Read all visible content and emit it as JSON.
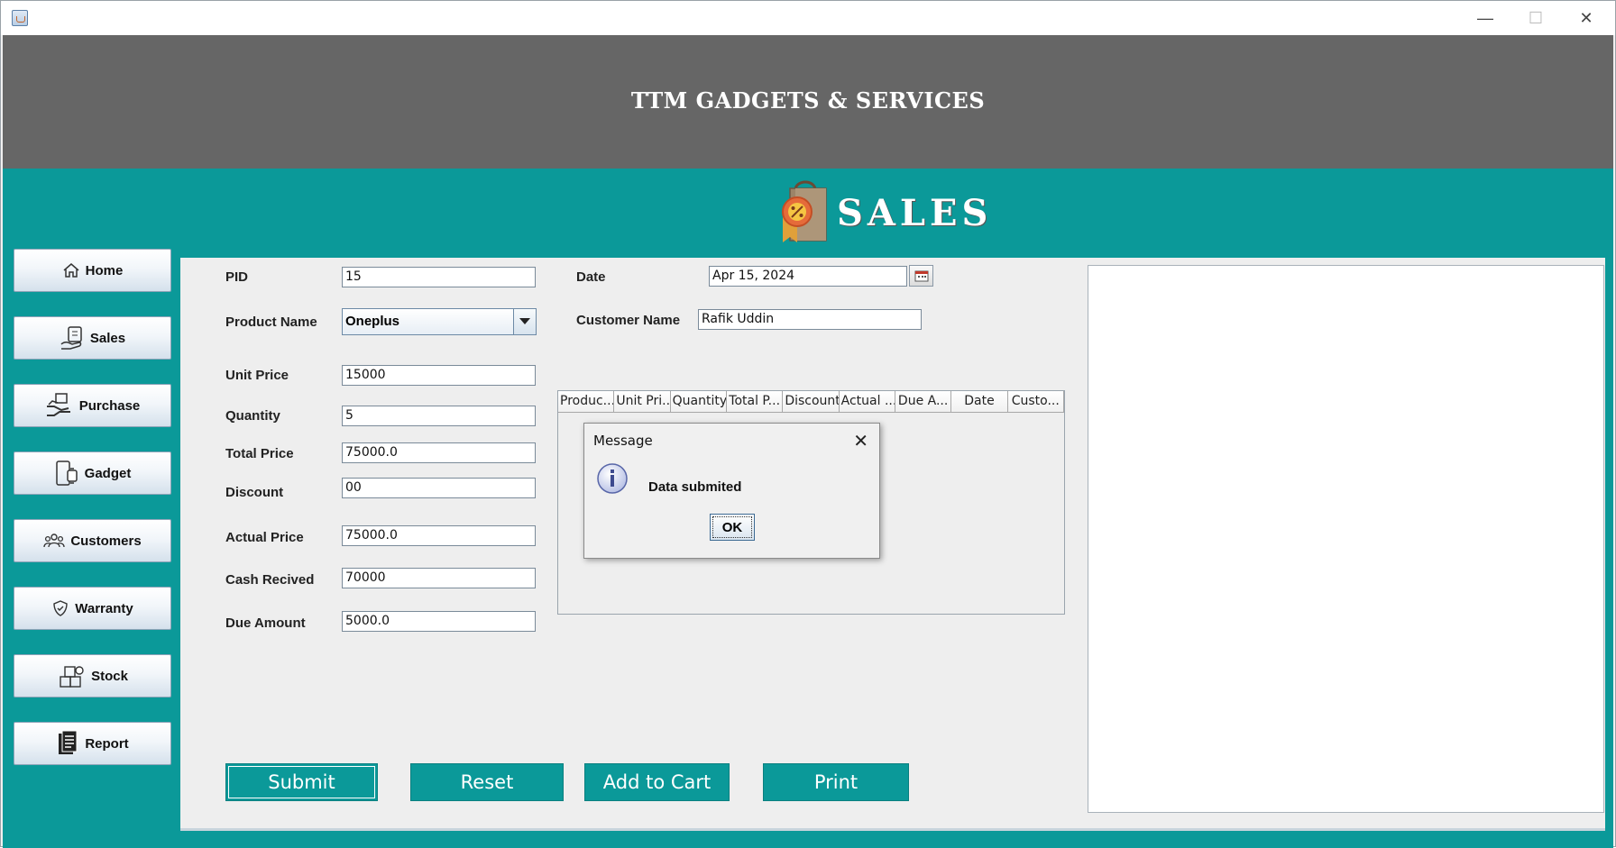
{
  "header": {
    "title": "TTM GADGETS & SERVICES"
  },
  "banner": {
    "title": "SALES"
  },
  "sidebar": {
    "items": [
      {
        "label": "Home",
        "icon": "home-icon"
      },
      {
        "label": "Sales",
        "icon": "sales-icon"
      },
      {
        "label": "Purchase",
        "icon": "purchase-icon"
      },
      {
        "label": "Gadget",
        "icon": "gadget-icon"
      },
      {
        "label": "Customers",
        "icon": "customers-icon"
      },
      {
        "label": "Warranty",
        "icon": "warranty-icon"
      },
      {
        "label": "Stock",
        "icon": "stock-icon"
      },
      {
        "label": "Report",
        "icon": "report-icon"
      }
    ]
  },
  "form": {
    "pid": {
      "label": "PID",
      "value": "15"
    },
    "product_name": {
      "label": "Product Name",
      "value": "Oneplus"
    },
    "unit_price": {
      "label": "Unit Price",
      "value": "15000"
    },
    "quantity": {
      "label": "Quantity",
      "value": "5"
    },
    "total_price": {
      "label": "Total Price",
      "value": "75000.0"
    },
    "discount": {
      "label": "Discount",
      "value": "00"
    },
    "actual_price": {
      "label": "Actual Price",
      "value": "75000.0"
    },
    "cash_received": {
      "label": "Cash Recived",
      "value": "70000"
    },
    "due_amount": {
      "label": "Due Amount",
      "value": "5000.0"
    },
    "date": {
      "label": "Date",
      "value": "Apr 15, 2024"
    },
    "customer_name": {
      "label": "Customer Name",
      "value": "Rafik Uddin"
    }
  },
  "table": {
    "columns": [
      "Produc...",
      "Unit Pri...",
      "Quantity",
      "Total P...",
      "Discount",
      "Actual ...",
      "Due A...",
      "Date",
      "Custo..."
    ]
  },
  "actions": {
    "submit": "Submit",
    "reset": "Reset",
    "add_to_cart": "Add to Cart",
    "print": "Print"
  },
  "dialog": {
    "title": "Message",
    "message": "Data submited",
    "ok": "OK"
  },
  "colors": {
    "header": "#666666",
    "accent": "#0b9999",
    "panel": "#eeeeee"
  }
}
